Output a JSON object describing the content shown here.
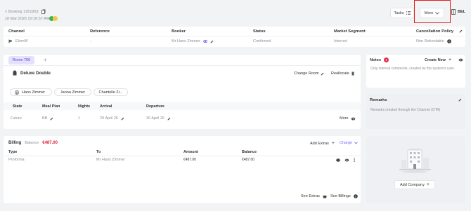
{
  "header": {
    "breadcrumb": "< Booking 1261953",
    "datetime": "18 Mar 2026 10:16:57 AM",
    "tasks_label": "Tasks",
    "more_label": "More",
    "user_label": "BEL"
  },
  "summary": {
    "columns": [
      "Channel",
      "Reference",
      "Booker",
      "Status",
      "Market Segment",
      "Cancellation Policy"
    ],
    "channel": "ElemW",
    "reference": "-",
    "booker": "Mr Hans Zimmer",
    "status": "Confirmed",
    "market_segment": "Internet",
    "cancellation_policy": "Non Refundable"
  },
  "room": {
    "tab_label": "Room 700",
    "add_tab": "+",
    "room_type": "Deluxe Double",
    "change_room": "Change Room",
    "reallocate": "Reallocate",
    "guests": [
      "Hans Zimmer",
      "Janna Zimmer",
      "Chantelle Zi..."
    ],
    "table_headers": [
      "State",
      "Meal Plan",
      "Nights",
      "Arrival",
      "Departure"
    ],
    "row": {
      "state": "Future",
      "meal_plan": "BB",
      "nights": "1",
      "arrival": "29 April 26",
      "departure": "30 April 26",
      "more": "More"
    }
  },
  "billing": {
    "title": "Billing",
    "balance_label": "Balance",
    "balance_value": "€487.00",
    "add_extras": "Add Extras",
    "charge": "Charge",
    "table_headers": [
      "Type",
      "To",
      "Amount",
      "Balance"
    ],
    "row": {
      "type": "Proforma",
      "to": "Mr Hans Zimmer",
      "amount": "€487.00",
      "balance": "€487.00"
    },
    "see_extras": "See Extras",
    "see_billings": "See Billings"
  },
  "notes": {
    "title": "Notes",
    "count": "1",
    "create_new": "Create New",
    "text": "Only internal comments, created by the system's user."
  },
  "remarks": {
    "title": "Remarks",
    "text": "Remarks created through the Channel (OTA)"
  },
  "company": {
    "add_company": "Add Company"
  },
  "colors": {
    "accent_purple": "#7b61ff",
    "balance_red": "#d9233a",
    "badge_red": "#e0314a",
    "highlight": "#e0211b"
  }
}
